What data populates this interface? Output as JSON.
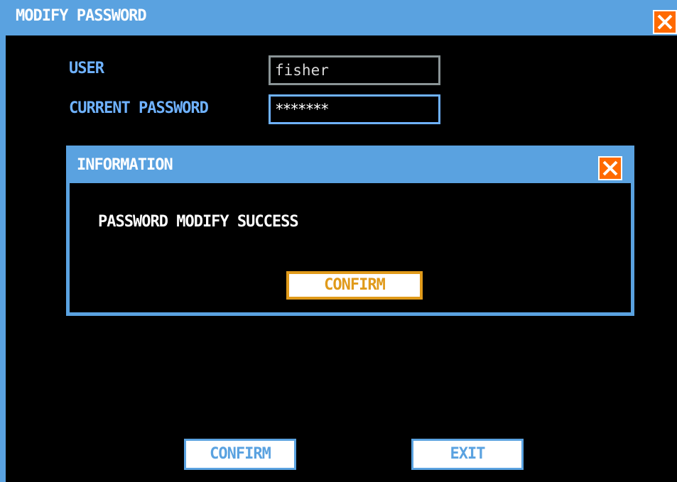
{
  "window": {
    "title": "MODIFY PASSWORD"
  },
  "form": {
    "user_label": "USER",
    "user_value": "fisher",
    "current_password_label": "CURRENT PASSWORD",
    "current_password_value": "*******"
  },
  "dialog": {
    "title": "INFORMATION",
    "message": "PASSWORD MODIFY SUCCESS",
    "confirm_label": "CONFIRM"
  },
  "buttons": {
    "confirm_label": "CONFIRM",
    "exit_label": "EXIT"
  },
  "icons": {
    "window_close": "close-icon",
    "dialog_close": "close-icon"
  },
  "colors": {
    "title_bar": "#5aa2e0",
    "label_text": "#6fb2ff",
    "close_button": "#ff6a00",
    "dialog_confirm_border": "#e09a1a",
    "background": "#000000"
  }
}
